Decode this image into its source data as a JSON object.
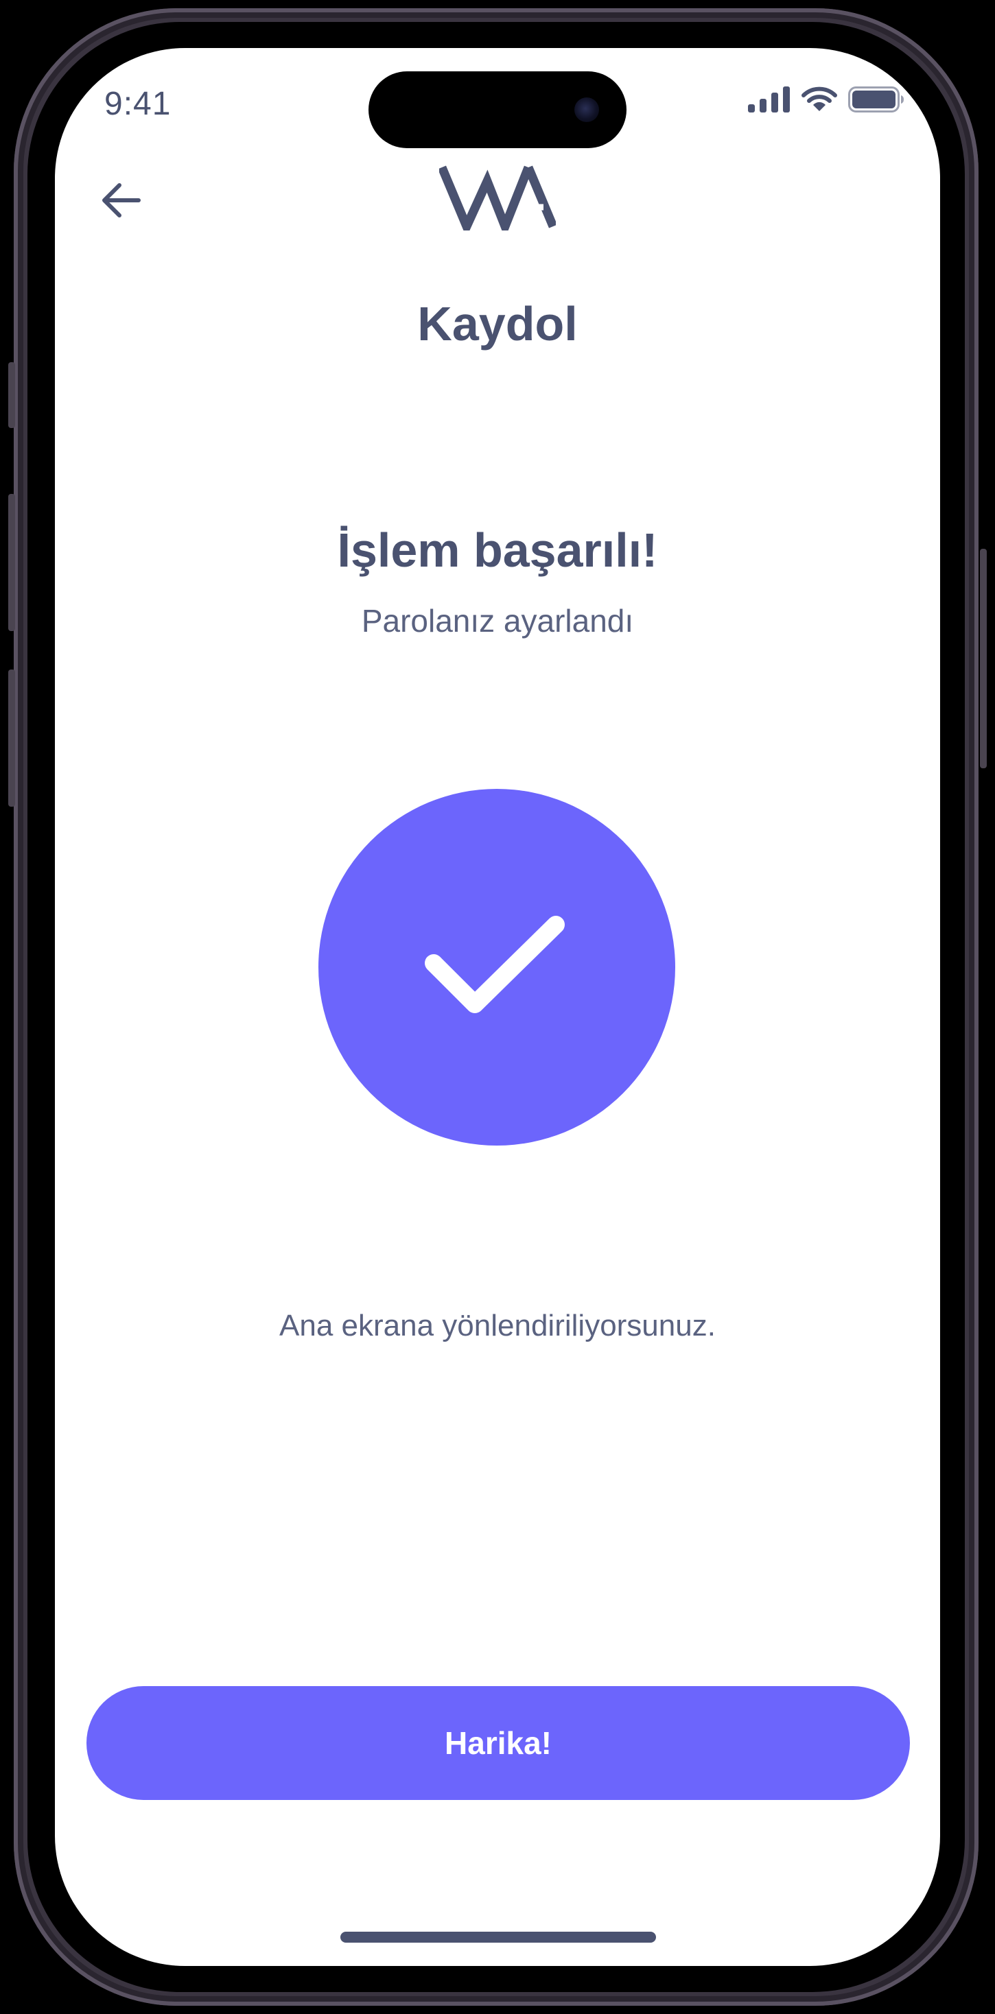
{
  "status_bar": {
    "time": "9:41",
    "icons": [
      "cellular-signal-icon",
      "wifi-icon",
      "battery-icon"
    ]
  },
  "header": {
    "back_icon": "arrow-left-icon",
    "logo_icon": "wa-logo-icon",
    "title": "Kaydol"
  },
  "main": {
    "success_title": "İşlem başarılı!",
    "success_subtitle": "Parolanız ayarlandı",
    "status_icon": "checkmark-icon",
    "redirect_text": "Ana ekrana yönlendiriliyorsunuz."
  },
  "footer": {
    "primary_button_label": "Harika!"
  },
  "colors": {
    "accent": "#6c65fc",
    "text_primary": "#4a5270",
    "text_secondary": "#5a6280",
    "background": "#ffffff"
  }
}
